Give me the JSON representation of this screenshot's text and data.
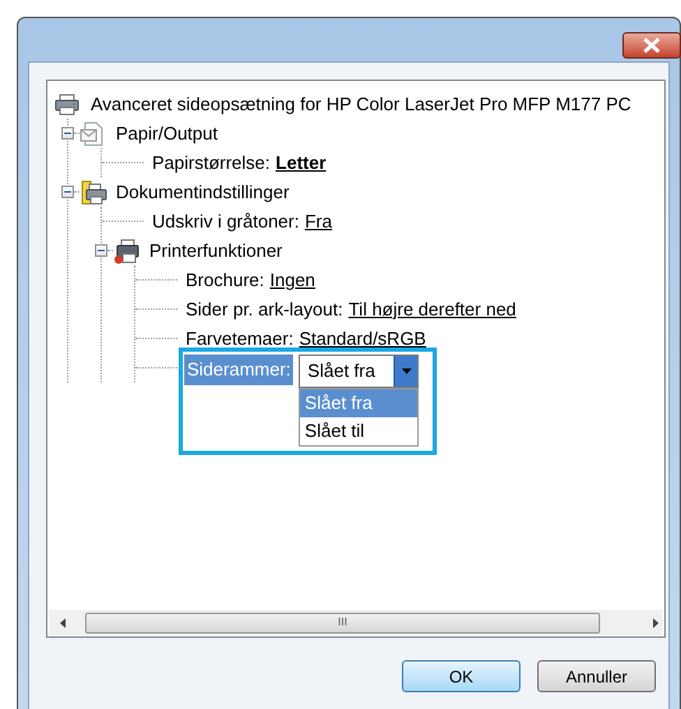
{
  "tree": {
    "label": "Avanceret sideopsætning for HP Color LaserJet Pro MFP M177 PC",
    "children": [
      {
        "label": "Papir/Output",
        "expanded": true,
        "children": [
          {
            "kind": "setting",
            "label": "Papirstørrelse:",
            "value": "Letter",
            "bold": true
          }
        ]
      },
      {
        "label": "Dokumentindstillinger",
        "expanded": true,
        "children": [
          {
            "kind": "setting",
            "label": "Udskriv i gråtoner:",
            "value": "Fra",
            "bold": false
          },
          {
            "label": "Printerfunktioner",
            "expanded": true,
            "children": [
              {
                "kind": "setting",
                "label": "Brochure:",
                "value": "Ingen",
                "bold": false
              },
              {
                "kind": "setting",
                "label": "Sider pr. ark-layout:",
                "value": "Til højre derefter ned",
                "bold": false
              },
              {
                "kind": "setting",
                "label": "Farvetemaer:",
                "value": "Standard/sRGB",
                "bold": false
              },
              {
                "kind": "combo",
                "label": "Siderammer:",
                "value": "Slået fra",
                "options": [
                  {
                    "label": "Slået fra",
                    "selected": true
                  },
                  {
                    "label": "Slået til",
                    "selected": false
                  }
                ]
              }
            ]
          }
        ]
      }
    ]
  },
  "scrollbar_grip": "III",
  "buttons": [
    {
      "label": "OK",
      "default": true
    },
    {
      "label": "Annuller",
      "default": false
    }
  ]
}
